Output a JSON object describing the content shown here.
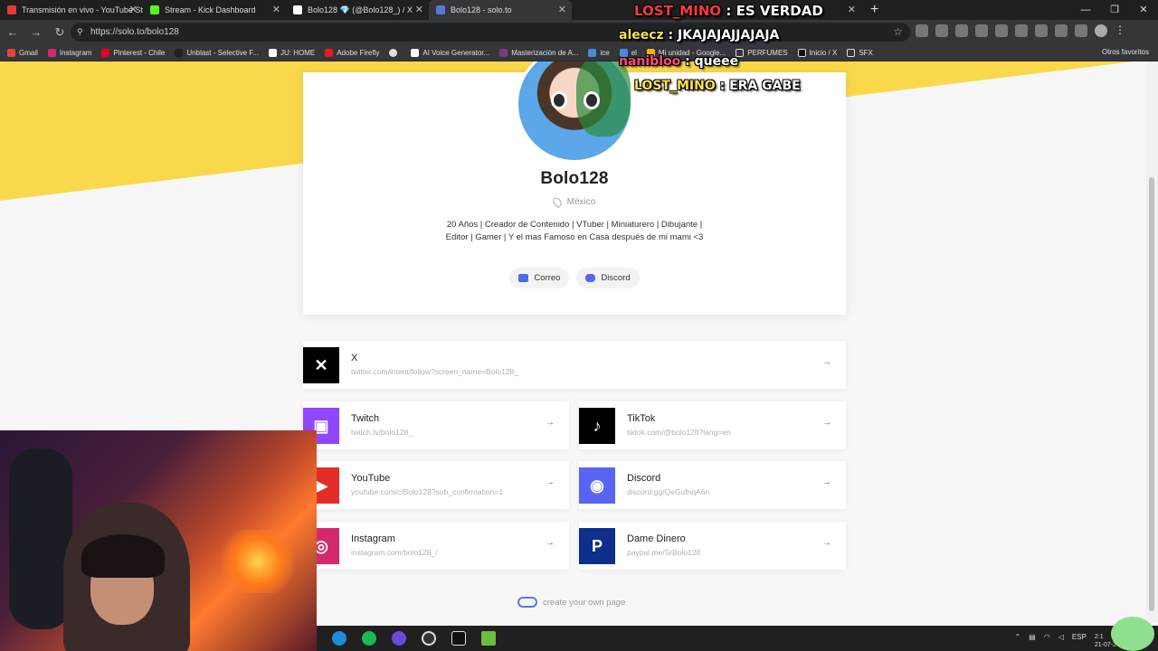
{
  "browser": {
    "tabs": [
      {
        "title": "Transmisión en vivo - YouTube St",
        "color": "#e53935"
      },
      {
        "title": "Stream - Kick Dashboard",
        "color": "#53fc18"
      },
      {
        "title": "Bolo128 💎 (@Bolo128_) / X",
        "color": "#ffffff"
      },
      {
        "title": "Bolo128 - solo.to",
        "color": "#5a78d8",
        "active": true
      },
      {
        "title": "YouTube",
        "color": "#e53935"
      }
    ],
    "url": "https://solo.to/bolo128",
    "bookmarks": [
      "Gmail",
      "Instagram",
      "Pinterest - Chile",
      "Unblast - Selective F...",
      "JU: HOME",
      "Adobe Firefly",
      "",
      "AI Voice Generator...",
      "Masterización de A...",
      "ice",
      "el",
      "Mi unidad - Google...",
      "PERFUMES",
      "Inicio / X",
      "SFX"
    ],
    "other_bookmarks": "Otros favoritos"
  },
  "profile": {
    "name": "Bolo128",
    "location": "México",
    "bio": "20 Años | Creador de Contenido | VTuber | Miniaturero | Dibujante | Editor | Gamer | Y el mas Famoso en Casa después de mi mami <3",
    "buttons": [
      "Correo",
      "Discord"
    ]
  },
  "links": [
    {
      "title": "X",
      "url": "twitter.com/intent/follow?screen_name=Bolo128_",
      "icon": "x-logo-icon",
      "color": "#000000",
      "glyph": "✕"
    },
    {
      "title": "Twitch",
      "url": "twitch.tv/bolo128_",
      "icon": "twitch-icon",
      "color": "#9146ff",
      "glyph": "▣"
    },
    {
      "title": "TikTok",
      "url": "tiktok.com/@bolo128?lang=en",
      "icon": "tiktok-icon",
      "color": "#000000",
      "glyph": "♪"
    },
    {
      "title": "YouTube",
      "url": "youtube.com/c/Bolo128?sub_confirmation=1",
      "icon": "youtube-icon",
      "color": "#e52d27",
      "glyph": "▶"
    },
    {
      "title": "Discord",
      "url": "discord.gg/QeGufnqA6n",
      "icon": "discord-icon",
      "color": "#5865f2",
      "glyph": "◉"
    },
    {
      "title": "Instagram",
      "url": "instagram.com/bolo128_/",
      "icon": "instagram-icon",
      "color": "#d6296b",
      "glyph": "◎"
    },
    {
      "title": "Dame Dinero",
      "url": "paypal.me/SrBolo128",
      "icon": "paypal-icon",
      "color": "#0b2f8a",
      "glyph": "P"
    }
  ],
  "footer": "create your own page",
  "chat": [
    {
      "user": "LOST_MINO",
      "text": "ES VERDAD"
    },
    {
      "user": "aleecz",
      "text": "JKAJAJAJJAJAJA"
    },
    {
      "user": "nanibloo",
      "text": "queee"
    },
    {
      "user": "LOST_MINO",
      "text": "ERA GABE"
    }
  ],
  "taskbar": {
    "lang": "ESP",
    "time": "2:1",
    "date": "21-07-2"
  }
}
